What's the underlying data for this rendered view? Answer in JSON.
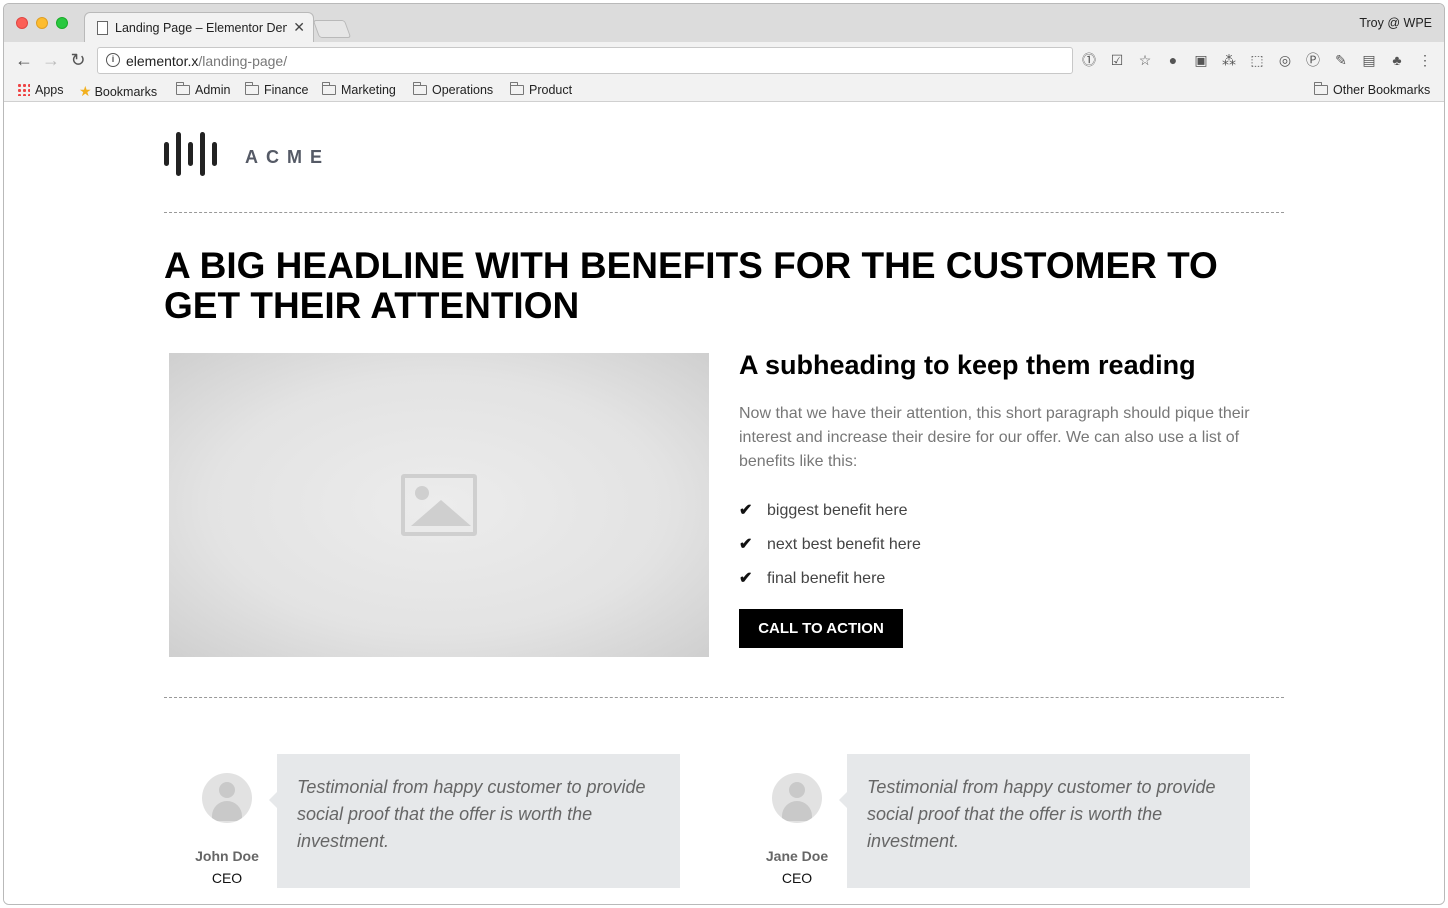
{
  "browser": {
    "tab_title": "Landing Page – Elementor Demo",
    "tab_close": "✕",
    "profile": "Troy @ WPE",
    "url_domain": "elementor.x",
    "url_path": "/landing-page/",
    "nav": {
      "back": "←",
      "forward": "→",
      "reload": "↻"
    },
    "extensions": [
      "1password-icon",
      "pocket-icon",
      "star-icon",
      "instapaper-icon",
      "facebook-icon",
      "asana-icon",
      "screenshot-icon",
      "chrome-sync-icon",
      "pinterest-icon",
      "pencil-icon",
      "stripes-icon",
      "evernote-icon",
      "menu-icon"
    ],
    "extension_glyphs": [
      "⓵",
      "☑",
      "☆",
      "●",
      "▣",
      "⁂",
      "⬚",
      "◎",
      "Ⓟ",
      "✎",
      "▤",
      "♣",
      "⋮"
    ],
    "bookmarks": {
      "apps": "Apps",
      "items": [
        "Bookmarks",
        "Admin",
        "Finance",
        "Marketing",
        "Operations",
        "Product"
      ],
      "other": "Other Bookmarks"
    }
  },
  "page": {
    "brand": "ACME",
    "headline": "A BIG HEADLINE WITH BENEFITS FOR THE CUSTOMER TO GET THEIR ATTENTION",
    "subheading": "A subheading to keep them reading",
    "paragraph": "Now that we have their attention, this short paragraph should pique their interest and increase their desire for our offer. We can also use a list of benefits like this:",
    "benefits": [
      "biggest benefit here",
      "next best benefit here",
      "final benefit here"
    ],
    "check_glyph": "✔",
    "cta": "CALL TO ACTION",
    "testimonials": [
      {
        "quote": "Testimonial from happy customer to provide social proof that the offer is worth the investment.",
        "name": "John Doe",
        "title": "CEO"
      },
      {
        "quote": "Testimonial from happy customer to provide social proof that the offer is worth the investment.",
        "name": "Jane Doe",
        "title": "CEO"
      }
    ]
  },
  "colors": {
    "accent": "#000000",
    "testimonial_bg": "#e6e8ea",
    "body_text": "#777777"
  }
}
